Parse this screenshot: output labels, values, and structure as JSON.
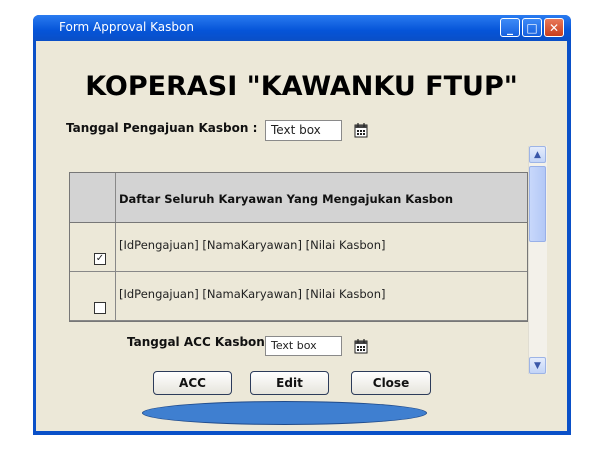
{
  "window": {
    "title": "Form Approval Kasbon"
  },
  "titlebar_buttons": {
    "minimize": "_",
    "maximize": "□",
    "close": "✕"
  },
  "heading": "KOPERASI \"KAWANKU FTUP\"",
  "pengajuan": {
    "label": "Tanggal Pengajuan Kasbon :",
    "value": "Text box"
  },
  "table": {
    "header": "Daftar Seluruh Karyawan Yang Mengajukan Kasbon",
    "rows": [
      {
        "text": "[IdPengajuan] [NamaKaryawan] [Nilai Kasbon]",
        "checked": true,
        "mark": "✓"
      },
      {
        "text": "[IdPengajuan] [NamaKaryawan] [Nilai Kasbon]",
        "checked": false,
        "mark": ""
      }
    ]
  },
  "acc": {
    "label": "Tanggal ACC Kasbon :",
    "value": "Text box"
  },
  "buttons": {
    "acc": "ACC",
    "edit": "Edit",
    "close": "Close"
  },
  "icons": {
    "calendar": "calendar-icon",
    "scroll_up": "chevron-up-icon",
    "scroll_down": "chevron-down-icon"
  },
  "colors": {
    "titlebar": "#0554d8",
    "client": "#ece8d8",
    "ellipse": "#3f7fd0"
  }
}
